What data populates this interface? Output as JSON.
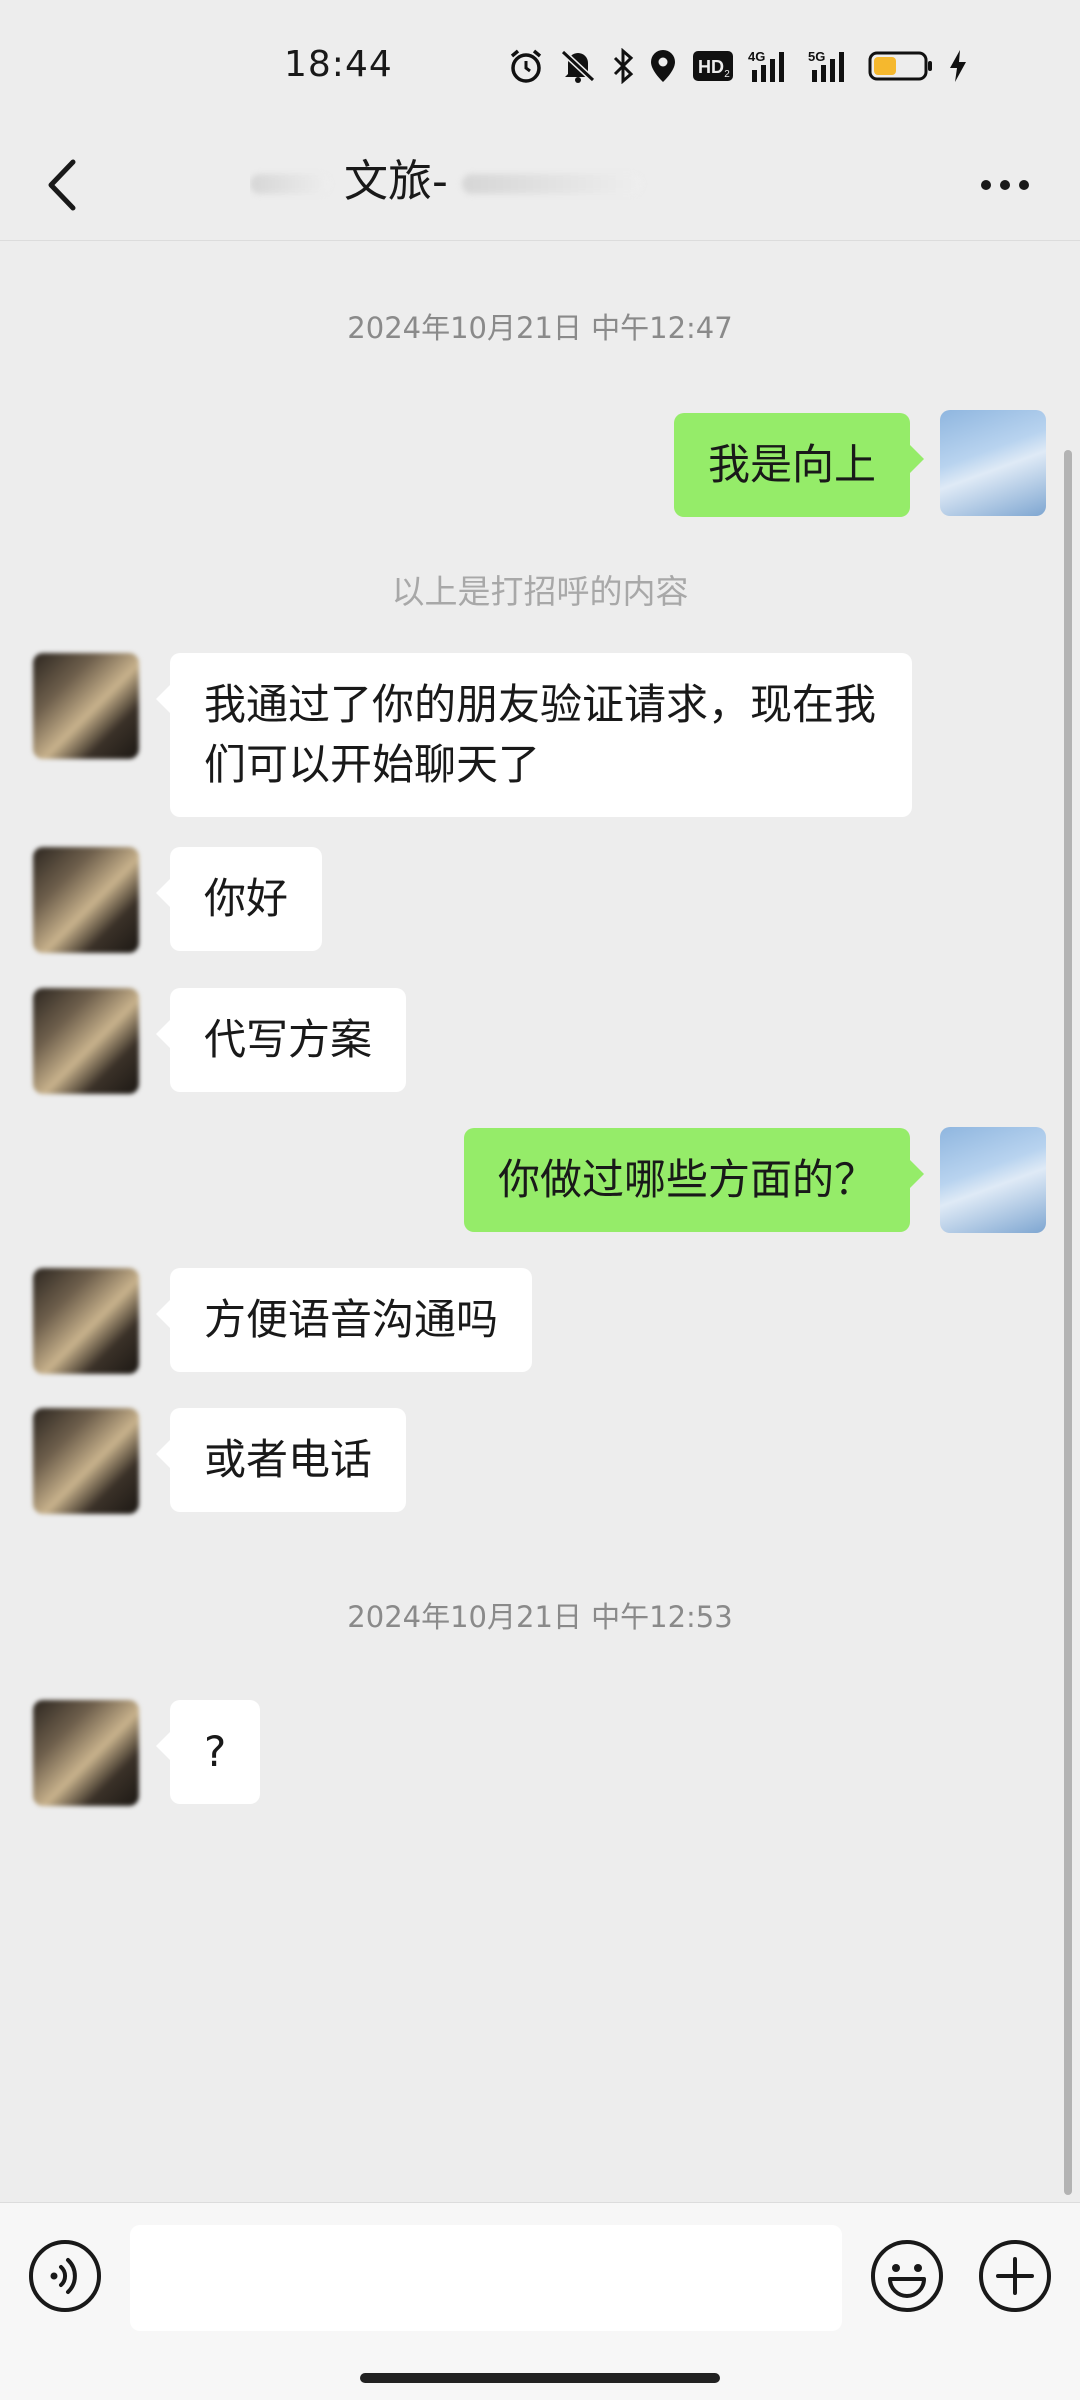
{
  "status_bar": {
    "time": "18:44",
    "icons": [
      "alarm-icon",
      "mute-icon",
      "bluetooth-icon",
      "location-icon",
      "hd-icon",
      "signal-4g-icon",
      "signal-5g-icon",
      "battery-icon",
      "charging-icon"
    ],
    "hd_label": "HD",
    "network_1": "4G",
    "network_2": "5G",
    "battery_level": 0.45,
    "battery_color": "#f5b82e"
  },
  "header": {
    "title": "文旅-"
  },
  "messages": {
    "ts1": "2024年10月21日 中午12:47",
    "out1": "我是向上",
    "note": "以上是打招呼的内容",
    "in1": "我通过了你的朋友验证请求，现在我们可以开始聊天了",
    "in2": "你好",
    "in3": "代写方案",
    "out2": "你做过哪些方面的？",
    "in4": "方便语音沟通吗",
    "in5": "或者电话",
    "ts2": "2024年10月21日 中午12:53",
    "in6": "?"
  },
  "input_bar": {
    "placeholder": "",
    "value": ""
  },
  "colors": {
    "background": "#ededed",
    "outgoing_bubble": "#95ec69",
    "incoming_bubble": "#ffffff"
  }
}
